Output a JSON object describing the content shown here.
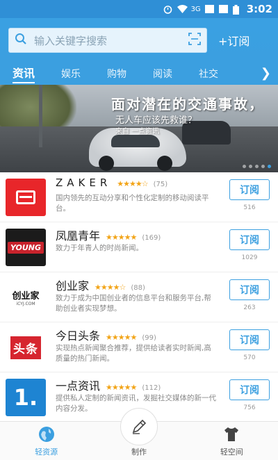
{
  "status_bar": {
    "network": "3G",
    "time": "3:02"
  },
  "search": {
    "placeholder": "输入关键字搜索"
  },
  "header": {
    "subscribe_label": "+订阅"
  },
  "tabs": [
    {
      "label": "资讯",
      "active": true
    },
    {
      "label": "娱乐",
      "active": false
    },
    {
      "label": "购物",
      "active": false
    },
    {
      "label": "阅读",
      "active": false
    },
    {
      "label": "社交",
      "active": false
    }
  ],
  "banner": {
    "headline": "面对潜在的交通事故，",
    "subline": "无人车应该先救谁？",
    "source": "来自 一点资讯"
  },
  "apps": [
    {
      "name": "ZAKER",
      "rating": "★★★★☆",
      "count": "(75)",
      "desc": "国内领先的互动分享和个性化定制的移动阅读平台。",
      "button": "订阅",
      "subscribers": "516",
      "logo": "zaker"
    },
    {
      "name": "凤凰青年",
      "rating": "★★★★★",
      "count": "(169)",
      "desc": "致力于年青人的时尚新闻。",
      "button": "订阅",
      "subscribers": "1029",
      "logo": "youth"
    },
    {
      "name": "创业家",
      "rating": "★★★★☆",
      "count": "(88)",
      "desc": "致力于成为中国创业者的信息平台和服务平台,帮助创业者实现梦想。",
      "button": "订阅",
      "subscribers": "263",
      "logo": "cyj"
    },
    {
      "name": "今日头条",
      "rating": "★★★★★",
      "count": "(99)",
      "desc": "实现热点新闻聚合推荐，提供给读者实时新闻,高质量的热门新闻。",
      "button": "订阅",
      "subscribers": "570",
      "logo": "toutiao"
    },
    {
      "name": "一点资讯",
      "rating": "★★★★★",
      "count": "(112)",
      "desc": "提供私人定制的新闻资讯，发掘社交媒体的新一代内容分发。",
      "button": "订阅",
      "subscribers": "756",
      "logo": "yidian"
    }
  ],
  "app_logos": {
    "zaker": "",
    "youth": "YOUNG",
    "cyj_main": "创业家",
    "cyj_small": "iCYJ.COM",
    "toutiao": "头条",
    "yidian": "1."
  },
  "bottom_nav": [
    {
      "label": "轻资源",
      "icon": "globe-icon",
      "active": true
    },
    {
      "label": "制作",
      "icon": "pen-icon",
      "active": false
    },
    {
      "label": "轻空间",
      "icon": "tshirt-icon",
      "active": false
    }
  ],
  "colors": {
    "accent": "#3b9fe0",
    "stars": "#f2a417",
    "zaker_red": "#e8262a",
    "toutiao_red": "#d6252f"
  }
}
